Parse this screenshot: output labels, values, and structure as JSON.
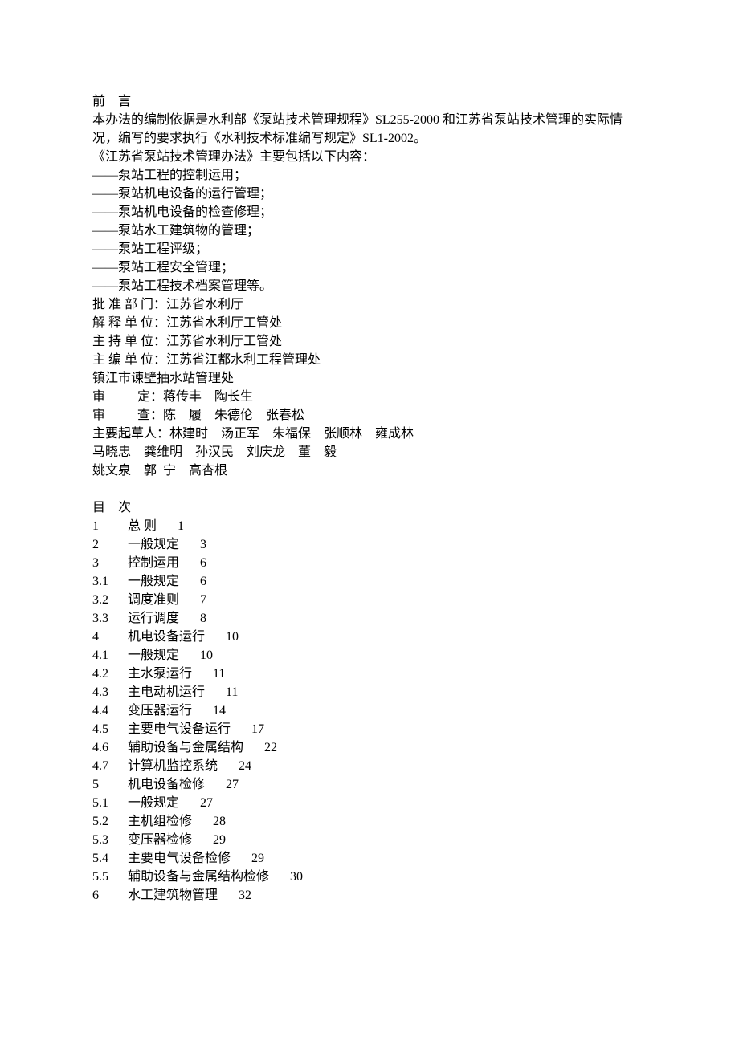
{
  "preface": {
    "heading": "前    言",
    "para1": "本办法的编制依据是水利部《泵站技术管理规程》SL255-2000 和江苏省泵站技术管理的实际情况，编写的要求执行《水利技术标准编写规定》SL1-2002。",
    "para2": "《江苏省泵站技术管理办法》主要包括以下内容：",
    "items": [
      "——泵站工程的控制运用；",
      "——泵站机电设备的运行管理；",
      "——泵站机电设备的检查修理；",
      "——泵站水工建筑物的管理；",
      "——泵站工程评级；",
      "——泵站工程安全管理；",
      "——泵站工程技术档案管理等。"
    ],
    "approval_dept": "批 准 部 门：江苏省水利厅",
    "interpret_unit": "解 释 单 位：江苏省水利厅工管处",
    "host_unit": "主 持 单 位：江苏省水利厅工管处",
    "editor_unit": "主 编 单 位：江苏省江都水利工程管理处",
    "editor_unit2": "镇江市谏壁抽水站管理处",
    "shending": "审          定：蒋传丰    陶长生",
    "shencha": "审          查：陈    履    朱德伦    张春松",
    "drafters1": "主要起草人：林建时    汤正军    朱福保    张顺林    雍成林",
    "drafters2": "马晓忠    龚维明    孙汉民    刘庆龙    董    毅",
    "drafters3": "姚文泉    郭  宁    高杏根"
  },
  "toc_heading": "目    次",
  "toc": [
    {
      "num": "1",
      "title": "总    则",
      "page": "1"
    },
    {
      "num": "2",
      "title": "一般规定",
      "page": "3"
    },
    {
      "num": "3",
      "title": "控制运用",
      "page": "6"
    },
    {
      "num": "3.1",
      "title": "一般规定",
      "page": "6"
    },
    {
      "num": "3.2",
      "title": "调度准则",
      "page": "7"
    },
    {
      "num": "3.3",
      "title": "运行调度",
      "page": "8"
    },
    {
      "num": "4",
      "title": "机电设备运行",
      "page": "10"
    },
    {
      "num": "4.1",
      "title": "一般规定",
      "page": "10"
    },
    {
      "num": "4.2",
      "title": "主水泵运行",
      "page": "11"
    },
    {
      "num": "4.3",
      "title": "主电动机运行",
      "page": "11"
    },
    {
      "num": "4.4",
      "title": "变压器运行",
      "page": "14"
    },
    {
      "num": "4.5",
      "title": "主要电气设备运行",
      "page": "17"
    },
    {
      "num": "4.6",
      "title": "辅助设备与金属结构",
      "page": "22"
    },
    {
      "num": "4.7",
      "title": "计算机监控系统",
      "page": "24"
    },
    {
      "num": "5",
      "title": "机电设备检修",
      "page": "27"
    },
    {
      "num": "5.1",
      "title": "一般规定",
      "page": "27"
    },
    {
      "num": "5.2",
      "title": "主机组检修",
      "page": "28"
    },
    {
      "num": "5.3",
      "title": "变压器检修",
      "page": "29"
    },
    {
      "num": "5.4",
      "title": "主要电气设备检修",
      "page": "29"
    },
    {
      "num": "5.5",
      "title": "辅助设备与金属结构检修",
      "page": "30"
    },
    {
      "num": "6",
      "title": "水工建筑物管理",
      "page": "32"
    }
  ]
}
